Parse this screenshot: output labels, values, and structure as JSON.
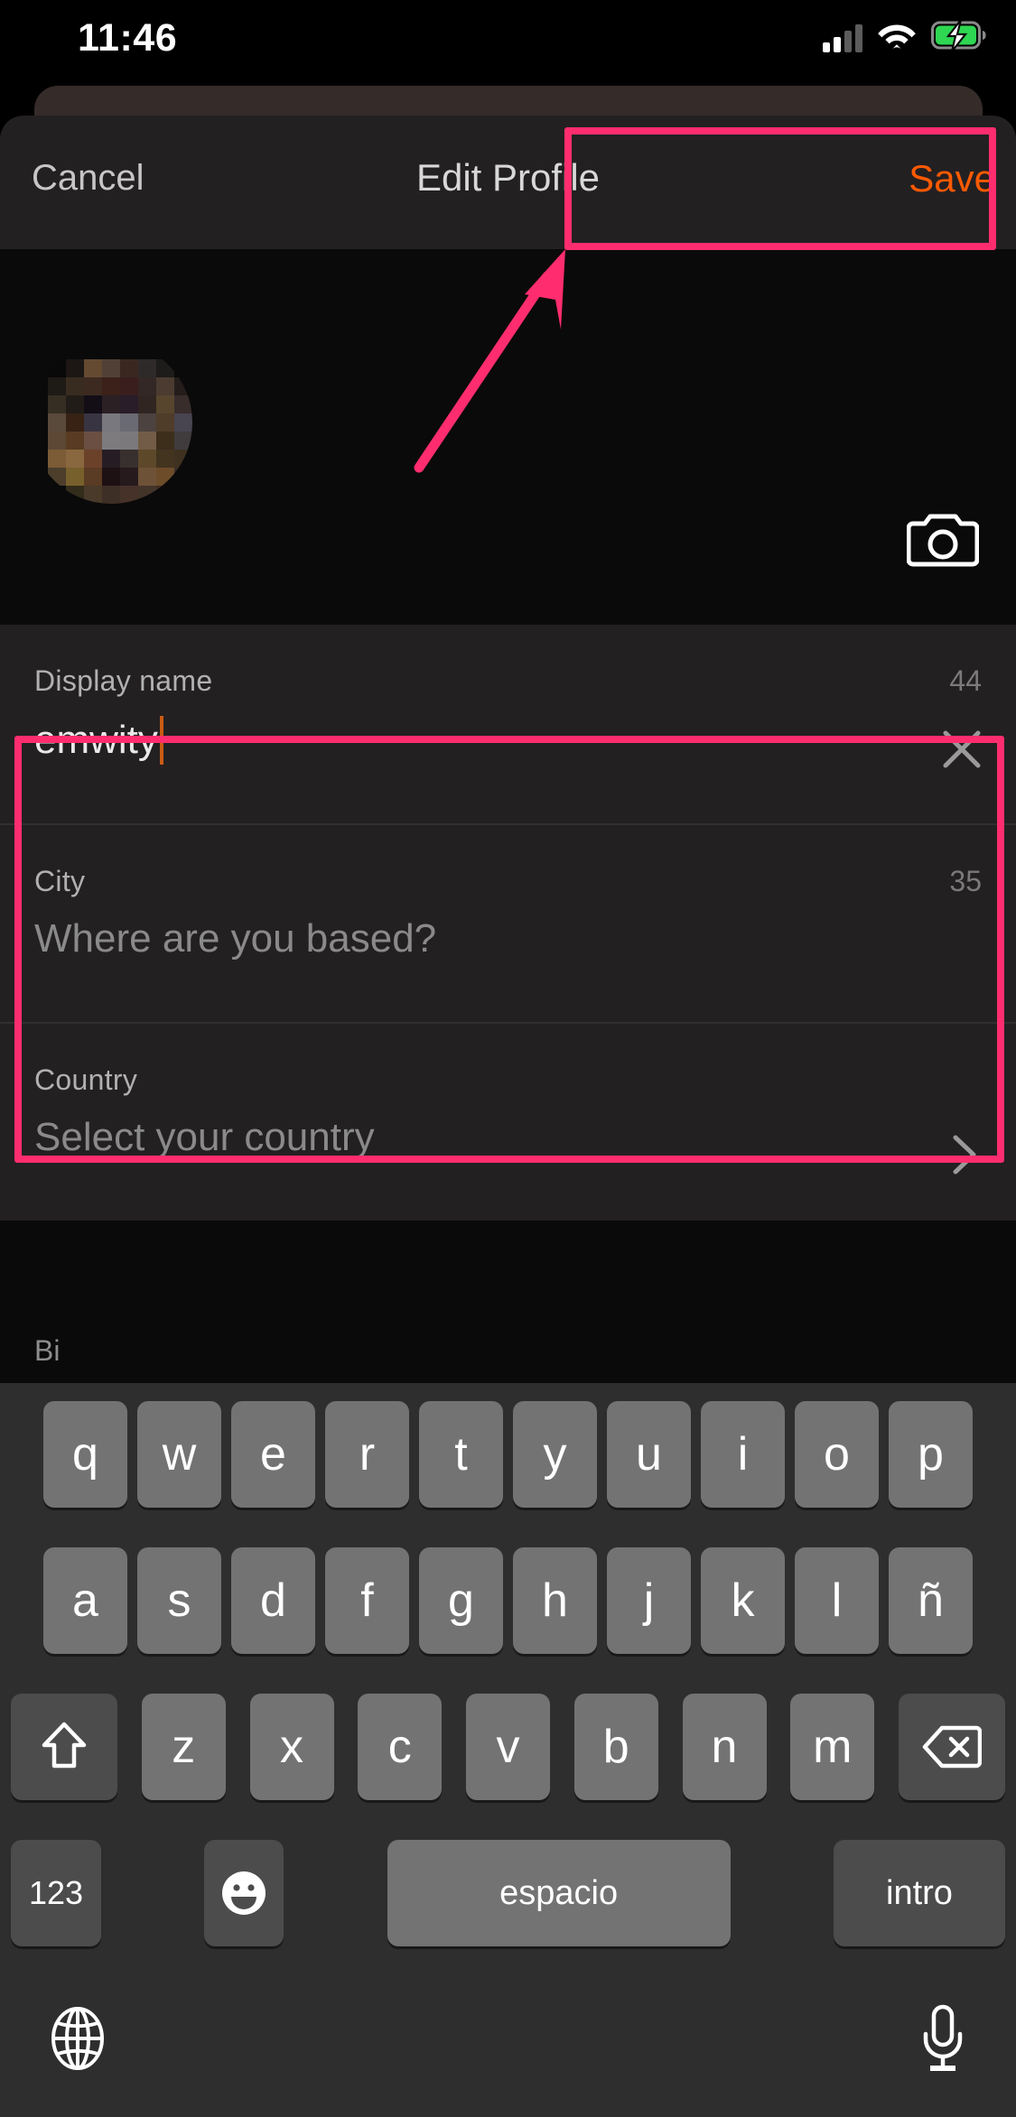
{
  "status_bar": {
    "time": "11:46",
    "signal_icon": "cellular-signal-icon",
    "wifi_icon": "wifi-icon",
    "battery_icon": "battery-charging-icon"
  },
  "nav": {
    "cancel_label": "Cancel",
    "title": "Edit Profile",
    "save_label": "Save",
    "save_color": "#FF5A00"
  },
  "avatar": {
    "camera_icon": "camera-icon"
  },
  "form": {
    "fields": [
      {
        "label": "Display name",
        "counter": "44",
        "value": "emwity",
        "placeholder": "",
        "has_caret": true,
        "trailing_icon": "clear-x-icon"
      },
      {
        "label": "City",
        "counter": "35",
        "value": "",
        "placeholder": "Where are you based?",
        "has_caret": false,
        "trailing_icon": ""
      },
      {
        "label": "Country",
        "counter": "",
        "value": "",
        "placeholder": "Select your country",
        "has_caret": false,
        "trailing_icon": "chevron-right-icon"
      }
    ],
    "partial_next_label": "Bi"
  },
  "annotations": {
    "color": "#FF2D6F",
    "save_box": "save-button-highlight",
    "form_box": "form-fields-highlight",
    "arrow": "pointer-arrow-to-save"
  },
  "keyboard": {
    "language": "espanol",
    "row1": [
      "q",
      "w",
      "e",
      "r",
      "t",
      "y",
      "u",
      "i",
      "o",
      "p"
    ],
    "row2": [
      "a",
      "s",
      "d",
      "f",
      "g",
      "h",
      "j",
      "k",
      "l",
      "ñ"
    ],
    "row3_letters": [
      "z",
      "x",
      "c",
      "v",
      "b",
      "n",
      "m"
    ],
    "shift_icon": "shift-arrow-up-icon",
    "backspace_icon": "backspace-delete-icon",
    "numbers_label": "123",
    "emoji_icon": "emoji-smiley-icon",
    "space_label": "espacio",
    "enter_label": "intro",
    "globe_icon": "globe-language-icon",
    "mic_icon": "microphone-dictation-icon"
  }
}
